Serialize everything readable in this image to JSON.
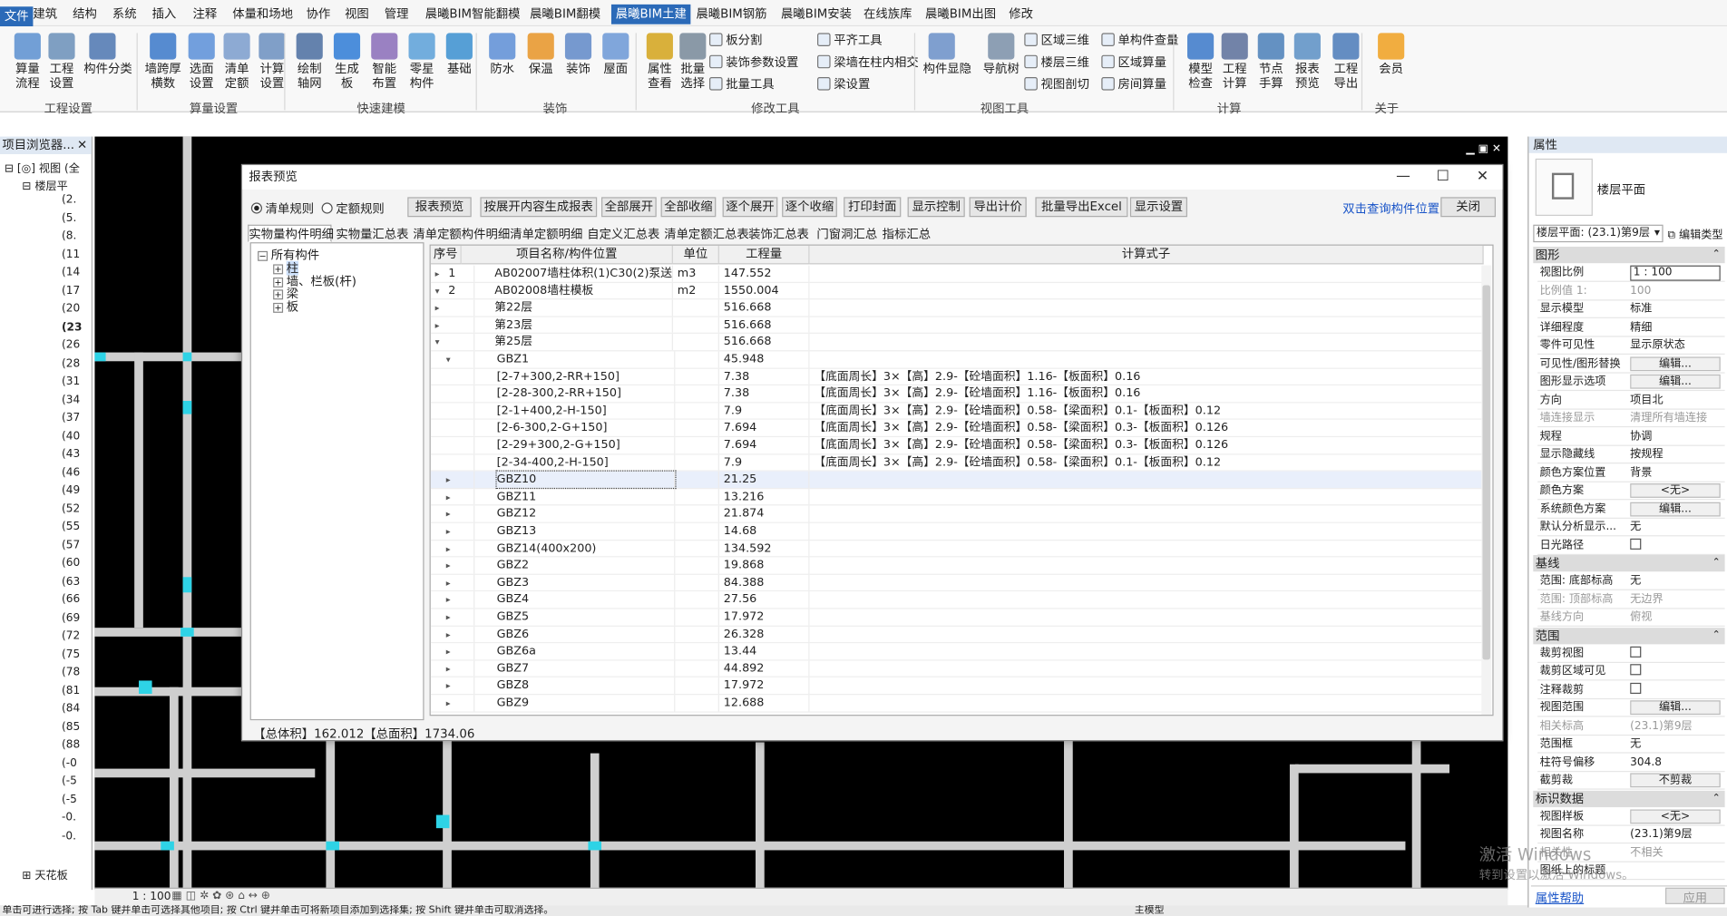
{
  "menubar": {
    "file": "文件",
    "items": [
      "建筑",
      "结构",
      "系统",
      "插入",
      "注释",
      "体量和场地",
      "协作",
      "视图",
      "管理",
      "晨曦BIM智能翻模",
      "晨曦BIM翻模",
      "晨曦BIM土建",
      "晨曦BIM钢筋",
      "晨曦BIM安装",
      "在线族库",
      "晨曦BIM出图",
      "修改"
    ],
    "active": "晨曦BIM土建"
  },
  "ribbon": {
    "buttons": [
      {
        "label": "算量\n流程",
        "icon": "flow-icon"
      },
      {
        "label": "工程\n设置",
        "icon": "project-settings-icon"
      },
      {
        "label": "构件分类",
        "icon": "classify-icon"
      },
      {
        "label": "墙跨厚\n横数",
        "icon": "wall-icon"
      },
      {
        "label": "选面\n设置",
        "icon": "face-icon"
      },
      {
        "label": "清单\n定额",
        "icon": "quota-icon"
      },
      {
        "label": "计算\n设置",
        "icon": "calc-settings-icon"
      },
      {
        "label": "绘制\n轴网",
        "icon": "grid-icon"
      },
      {
        "label": "生成\n板",
        "icon": "slab-icon"
      },
      {
        "label": "智能\n布置",
        "icon": "smart-icon"
      },
      {
        "label": "零星\n构件",
        "icon": "misc-icon"
      },
      {
        "label": "基础",
        "icon": "foundation-icon"
      },
      {
        "label": "防水",
        "icon": "waterproof-icon"
      },
      {
        "label": "保温",
        "icon": "insulation-icon"
      },
      {
        "label": "装饰",
        "icon": "decor-icon"
      },
      {
        "label": "屋面",
        "icon": "roof-icon"
      },
      {
        "label": "属性\n查看",
        "icon": "bulb-icon"
      },
      {
        "label": "批量\n选择",
        "icon": "filter-icon"
      },
      {
        "label": "构件显隐",
        "icon": "visibility-icon"
      },
      {
        "label": "导航树",
        "icon": "tree-icon"
      },
      {
        "label": "模型\n检查",
        "icon": "check-icon"
      },
      {
        "label": "工程\n计算",
        "icon": "sigma-icon"
      },
      {
        "label": "节点\n手算",
        "icon": "node-icon"
      },
      {
        "label": "报表\n预览",
        "icon": "report-icon"
      },
      {
        "label": "工程\n导出",
        "icon": "export-icon"
      },
      {
        "label": "会员",
        "icon": "member-icon"
      }
    ],
    "small": [
      "板分割",
      "装饰参数设置",
      "批量工具",
      "平齐工具",
      "梁墙在柱内相交",
      "梁设置",
      "区域三维",
      "楼层三维",
      "视图剖切",
      "单构件查量",
      "区域算量",
      "房间算量"
    ],
    "groups": [
      "工程设置",
      "算量设置",
      "快速建模",
      "装饰",
      "修改工具",
      "视图工具",
      "计算",
      "关于"
    ]
  },
  "left_panel": {
    "title": "项目浏览器...",
    "view_root": "视图 (全",
    "floor_plan": "楼层平",
    "items": [
      "(2.",
      "(5.",
      "(8.",
      "(11",
      "(14",
      "(17",
      "(20",
      "(23",
      "(26",
      "(28",
      "(31",
      "(34",
      "(37",
      "(40",
      "(43",
      "(46",
      "(49",
      "(52",
      "(55",
      "(57",
      "(60",
      "(63",
      "(66",
      "(69",
      "(72",
      "(75",
      "(78",
      "(81",
      "(84",
      "(85",
      "(88",
      "(-0",
      "(-5",
      "(-5",
      "-0.",
      "-0."
    ],
    "bottom": "天花板"
  },
  "viewbar": {
    "scale": "1 : 100"
  },
  "statusbar": {
    "text": "单击可进行选择; 按 Tab 键并单击可选择其他项目; 按 Ctrl 键并单击可将新项目添加到选择集; 按 Shift 键并单击可取消选择。",
    "model": "主模型"
  },
  "dialog": {
    "title": "报表预览",
    "radios": [
      "清单规则",
      "定额规则"
    ],
    "buttons": [
      "报表预览",
      "按展开内容生成报表",
      "全部展开",
      "全部收缩",
      "逐个展开",
      "逐个收缩",
      "打印封面",
      "显示控制",
      "导出计价",
      "批量导出Excel",
      "显示设置"
    ],
    "link": "双击查询构件位置",
    "close": "关闭",
    "tabs": [
      "实物量构件明细",
      "实物量汇总表",
      "清单定额构件明细",
      "清单定额明细",
      "自定义汇总表",
      "清单定额汇总表",
      "装饰汇总表",
      "门窗洞汇总",
      "指标汇总"
    ],
    "tree": {
      "root": "所有构件",
      "children": [
        "柱",
        "墙、栏板(杆)",
        "梁",
        "板"
      ]
    },
    "columns": [
      "序号",
      "项目名称/构件位置",
      "单位",
      "工程量",
      "计算式子"
    ],
    "rows": [
      {
        "no": "1",
        "name": "AB02007墙柱体积(1)C30(2)泵送...",
        "unit": "m3",
        "qty": "147.552",
        "formula": "",
        "lvl": 0,
        "exp": "▸"
      },
      {
        "no": "2",
        "name": "AB02008墙柱模板",
        "unit": "m2",
        "qty": "1550.004",
        "formula": "",
        "lvl": 0,
        "exp": "▾"
      },
      {
        "no": "",
        "name": "第22层",
        "unit": "",
        "qty": "516.668",
        "formula": "",
        "lvl": 1,
        "exp": "▸"
      },
      {
        "no": "",
        "name": "第23层",
        "unit": "",
        "qty": "516.668",
        "formula": "",
        "lvl": 1,
        "exp": "▸"
      },
      {
        "no": "",
        "name": "第25层",
        "unit": "",
        "qty": "516.668",
        "formula": "",
        "lvl": 1,
        "exp": "▾"
      },
      {
        "no": "",
        "name": "GBZ1",
        "unit": "",
        "qty": "45.948",
        "formula": "",
        "lvl": 2,
        "exp": "▾"
      },
      {
        "no": "",
        "name": "[2-7+300,2-RR+150]",
        "unit": "",
        "qty": "7.38",
        "formula": "【底面周长】3×【高】2.9-【砼墙面积】1.16-【板面积】0.16",
        "lvl": 3,
        "exp": ""
      },
      {
        "no": "",
        "name": "[2-28-300,2-RR+150]",
        "unit": "",
        "qty": "7.38",
        "formula": "【底面周长】3×【高】2.9-【砼墙面积】1.16-【板面积】0.16",
        "lvl": 3,
        "exp": ""
      },
      {
        "no": "",
        "name": "[2-1+400,2-H-150]",
        "unit": "",
        "qty": "7.9",
        "formula": "【底面周长】3×【高】2.9-【砼墙面积】0.58-【梁面积】0.1-【板面积】0.12",
        "lvl": 3,
        "exp": ""
      },
      {
        "no": "",
        "name": "[2-6-300,2-G+150]",
        "unit": "",
        "qty": "7.694",
        "formula": "【底面周长】3×【高】2.9-【砼墙面积】0.58-【梁面积】0.3-【板面积】0.126",
        "lvl": 3,
        "exp": ""
      },
      {
        "no": "",
        "name": "[2-29+300,2-G+150]",
        "unit": "",
        "qty": "7.694",
        "formula": "【底面周长】3×【高】2.9-【砼墙面积】0.58-【梁面积】0.3-【板面积】0.126",
        "lvl": 3,
        "exp": ""
      },
      {
        "no": "",
        "name": "[2-34-400,2-H-150]",
        "unit": "",
        "qty": "7.9",
        "formula": "【底面周长】3×【高】2.9-【砼墙面积】0.58-【梁面积】0.1-【板面积】0.12",
        "lvl": 3,
        "exp": ""
      },
      {
        "no": "",
        "name": "GBZ10",
        "unit": "",
        "qty": "21.25",
        "formula": "",
        "lvl": 2,
        "exp": "▸",
        "sel": true
      },
      {
        "no": "",
        "name": "GBZ11",
        "unit": "",
        "qty": "13.216",
        "formula": "",
        "lvl": 2,
        "exp": "▸"
      },
      {
        "no": "",
        "name": "GBZ12",
        "unit": "",
        "qty": "21.874",
        "formula": "",
        "lvl": 2,
        "exp": "▸"
      },
      {
        "no": "",
        "name": "GBZ13",
        "unit": "",
        "qty": "14.68",
        "formula": "",
        "lvl": 2,
        "exp": "▸"
      },
      {
        "no": "",
        "name": "GBZ14(400x200)",
        "unit": "",
        "qty": "134.592",
        "formula": "",
        "lvl": 2,
        "exp": "▸"
      },
      {
        "no": "",
        "name": "GBZ2",
        "unit": "",
        "qty": "19.868",
        "formula": "",
        "lvl": 2,
        "exp": "▸"
      },
      {
        "no": "",
        "name": "GBZ3",
        "unit": "",
        "qty": "84.388",
        "formula": "",
        "lvl": 2,
        "exp": "▸"
      },
      {
        "no": "",
        "name": "GBZ4",
        "unit": "",
        "qty": "27.56",
        "formula": "",
        "lvl": 2,
        "exp": "▸"
      },
      {
        "no": "",
        "name": "GBZ5",
        "unit": "",
        "qty": "17.972",
        "formula": "",
        "lvl": 2,
        "exp": "▸"
      },
      {
        "no": "",
        "name": "GBZ6",
        "unit": "",
        "qty": "26.328",
        "formula": "",
        "lvl": 2,
        "exp": "▸"
      },
      {
        "no": "",
        "name": "GBZ6a",
        "unit": "",
        "qty": "13.44",
        "formula": "",
        "lvl": 2,
        "exp": "▸"
      },
      {
        "no": "",
        "name": "GBZ7",
        "unit": "",
        "qty": "44.892",
        "formula": "",
        "lvl": 2,
        "exp": "▸"
      },
      {
        "no": "",
        "name": "GBZ8",
        "unit": "",
        "qty": "17.972",
        "formula": "",
        "lvl": 2,
        "exp": "▸"
      },
      {
        "no": "",
        "name": "GBZ9",
        "unit": "",
        "qty": "12.688",
        "formula": "",
        "lvl": 2,
        "exp": "▸"
      }
    ],
    "footer": "【总体积】162.012【总面积】1734.06"
  },
  "properties": {
    "title": "属性",
    "type_name": "楼层平面",
    "selector": "楼层平面: (23.1)第9层",
    "edit_type": "编辑类型",
    "sections": [
      {
        "name": "图形",
        "rows": [
          {
            "k": "视图比例",
            "v": "1 : 100",
            "kind": "input"
          },
          {
            "k": "比例值 1:",
            "v": "100",
            "kind": "dim"
          },
          {
            "k": "显示模型",
            "v": "标准"
          },
          {
            "k": "详细程度",
            "v": "精细"
          },
          {
            "k": "零件可见性",
            "v": "显示原状态"
          },
          {
            "k": "可见性/图形替换",
            "v": "编辑...",
            "kind": "btn"
          },
          {
            "k": "图形显示选项",
            "v": "编辑...",
            "kind": "btn"
          },
          {
            "k": "方向",
            "v": "项目北"
          },
          {
            "k": "墙连接显示",
            "v": "清理所有墙连接",
            "kind": "dim"
          },
          {
            "k": "规程",
            "v": "协调"
          },
          {
            "k": "显示隐藏线",
            "v": "按规程"
          },
          {
            "k": "颜色方案位置",
            "v": "背景"
          },
          {
            "k": "颜色方案",
            "v": "<无>",
            "kind": "btn"
          },
          {
            "k": "系统颜色方案",
            "v": "编辑...",
            "kind": "btn"
          },
          {
            "k": "默认分析显示...",
            "v": "无"
          },
          {
            "k": "日光路径",
            "v": "",
            "kind": "chk"
          }
        ]
      },
      {
        "name": "基线",
        "rows": [
          {
            "k": "范围: 底部标高",
            "v": "无"
          },
          {
            "k": "范围: 顶部标高",
            "v": "无边界",
            "kind": "dim"
          },
          {
            "k": "基线方向",
            "v": "俯视",
            "kind": "dim"
          }
        ]
      },
      {
        "name": "范围",
        "rows": [
          {
            "k": "裁剪视图",
            "v": "",
            "kind": "chk"
          },
          {
            "k": "裁剪区域可见",
            "v": "",
            "kind": "chk"
          },
          {
            "k": "注释裁剪",
            "v": "",
            "kind": "chk"
          },
          {
            "k": "视图范围",
            "v": "编辑...",
            "kind": "btn"
          },
          {
            "k": "相关标高",
            "v": "(23.1)第9层",
            "kind": "dim"
          },
          {
            "k": "范围框",
            "v": "无"
          },
          {
            "k": "柱符号偏移",
            "v": "304.8"
          },
          {
            "k": "截剪裁",
            "v": "不剪裁",
            "kind": "btn"
          }
        ]
      },
      {
        "name": "标识数据",
        "rows": [
          {
            "k": "视图样板",
            "v": "<无>",
            "kind": "btn"
          },
          {
            "k": "视图名称",
            "v": "(23.1)第9层"
          },
          {
            "k": "相关性",
            "v": "不相关",
            "kind": "dim"
          },
          {
            "k": "图纸上的标题",
            "v": ""
          }
        ]
      }
    ],
    "help": "属性帮助",
    "apply": "应用"
  },
  "watermark": {
    "line1": "激活 Windows",
    "line2": "转到设置以激活 Windows。"
  }
}
